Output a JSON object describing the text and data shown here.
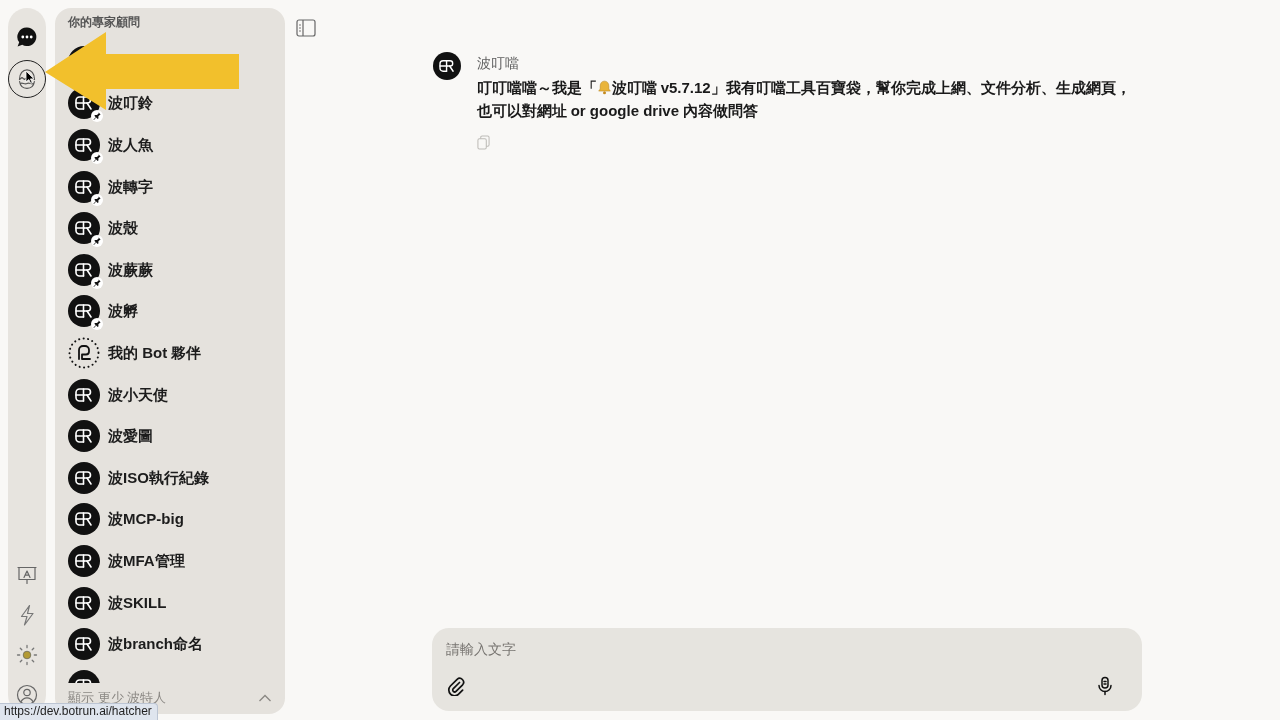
{
  "rail": {
    "top": [
      {
        "kind": "chat",
        "selected": false
      },
      {
        "kind": "hatcher",
        "selected": true
      }
    ],
    "bottom": [
      {
        "kind": "slides"
      },
      {
        "kind": "lightning"
      },
      {
        "kind": "theme"
      },
      {
        "kind": "account"
      }
    ]
  },
  "sidebar": {
    "title": "你的專家顧問",
    "items": [
      {
        "kind": "bot"
      },
      {
        "kind": "bot",
        "name": "波叮鈴",
        "pinned": true
      },
      {
        "kind": "bot",
        "name": "波人魚",
        "pinned": true
      },
      {
        "kind": "bot",
        "name": "波轉字",
        "pinned": true
      },
      {
        "kind": "bot",
        "name": "波殼",
        "pinned": true
      },
      {
        "kind": "bot",
        "name": "波蕨蕨",
        "pinned": true
      },
      {
        "kind": "bot",
        "name": "波孵",
        "pinned": true
      },
      {
        "kind": "my-bots",
        "name": "我的 Bot 夥伴",
        "pinned": false
      },
      {
        "kind": "bot",
        "name": "波小天使",
        "pinned": false
      },
      {
        "kind": "bot",
        "name": "波愛圖",
        "pinned": false
      },
      {
        "kind": "bot",
        "name": "波ISO執行紀錄",
        "pinned": false
      },
      {
        "kind": "bot",
        "name": "波MCP-big",
        "pinned": false
      },
      {
        "kind": "bot",
        "name": "波MFA管理",
        "pinned": false
      },
      {
        "kind": "bot",
        "name": "波SKILL",
        "pinned": false
      },
      {
        "kind": "bot",
        "name": "波branch命名",
        "pinned": false
      },
      {
        "kind": "bot"
      }
    ],
    "footer": {
      "label": "顯示 更少 波特人",
      "expanded": true
    }
  },
  "chat": {
    "message": {
      "sender": "波叮噹",
      "lines": [
        {
          "parts": [
            {
              "kind": "text",
              "text": "叮叮噹噹～我是「"
            },
            {
              "kind": "bell"
            },
            {
              "kind": "text",
              "text": "波叮噹 v5.7.12」我有叮噹工具百寶袋，幫你完成上網、文件分析、生成網頁，"
            }
          ]
        },
        {
          "parts": [
            {
              "kind": "text",
              "text": "也可以對網址 or google drive 內容做問答"
            }
          ]
        }
      ]
    }
  },
  "composer": {
    "placeholder": "請輸入文字"
  },
  "status_bar": {
    "url": "https://dev.botrun.ai/hatcher"
  },
  "annotation": {
    "kind": "arrow"
  }
}
